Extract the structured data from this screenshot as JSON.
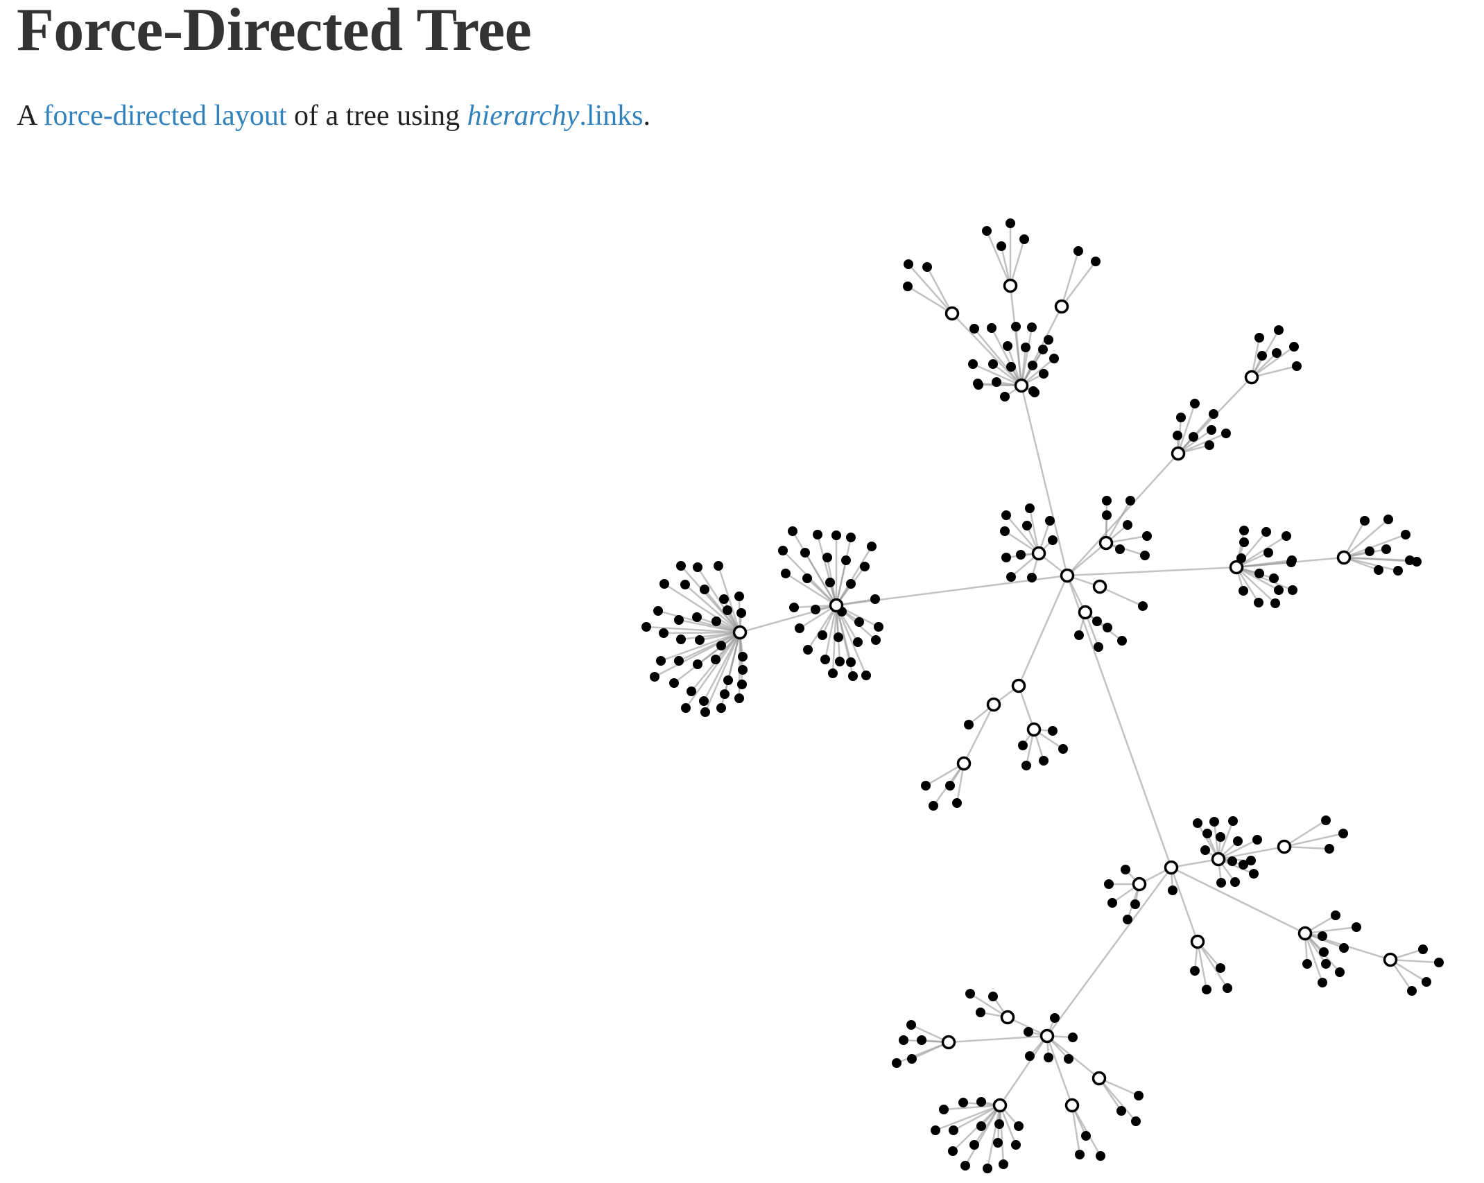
{
  "header": {
    "title": "Force-Directed Tree"
  },
  "intro": {
    "prefix": "A ",
    "link_layout": "force-directed layout",
    "middle": " of a tree using ",
    "link_hierarchy": "hierarchy",
    "link_links": ".links",
    "suffix": "."
  },
  "colors": {
    "link": "#3182bd",
    "edge": "#999999",
    "leaf": "#000000",
    "branch_fill": "#ffffff"
  }
}
